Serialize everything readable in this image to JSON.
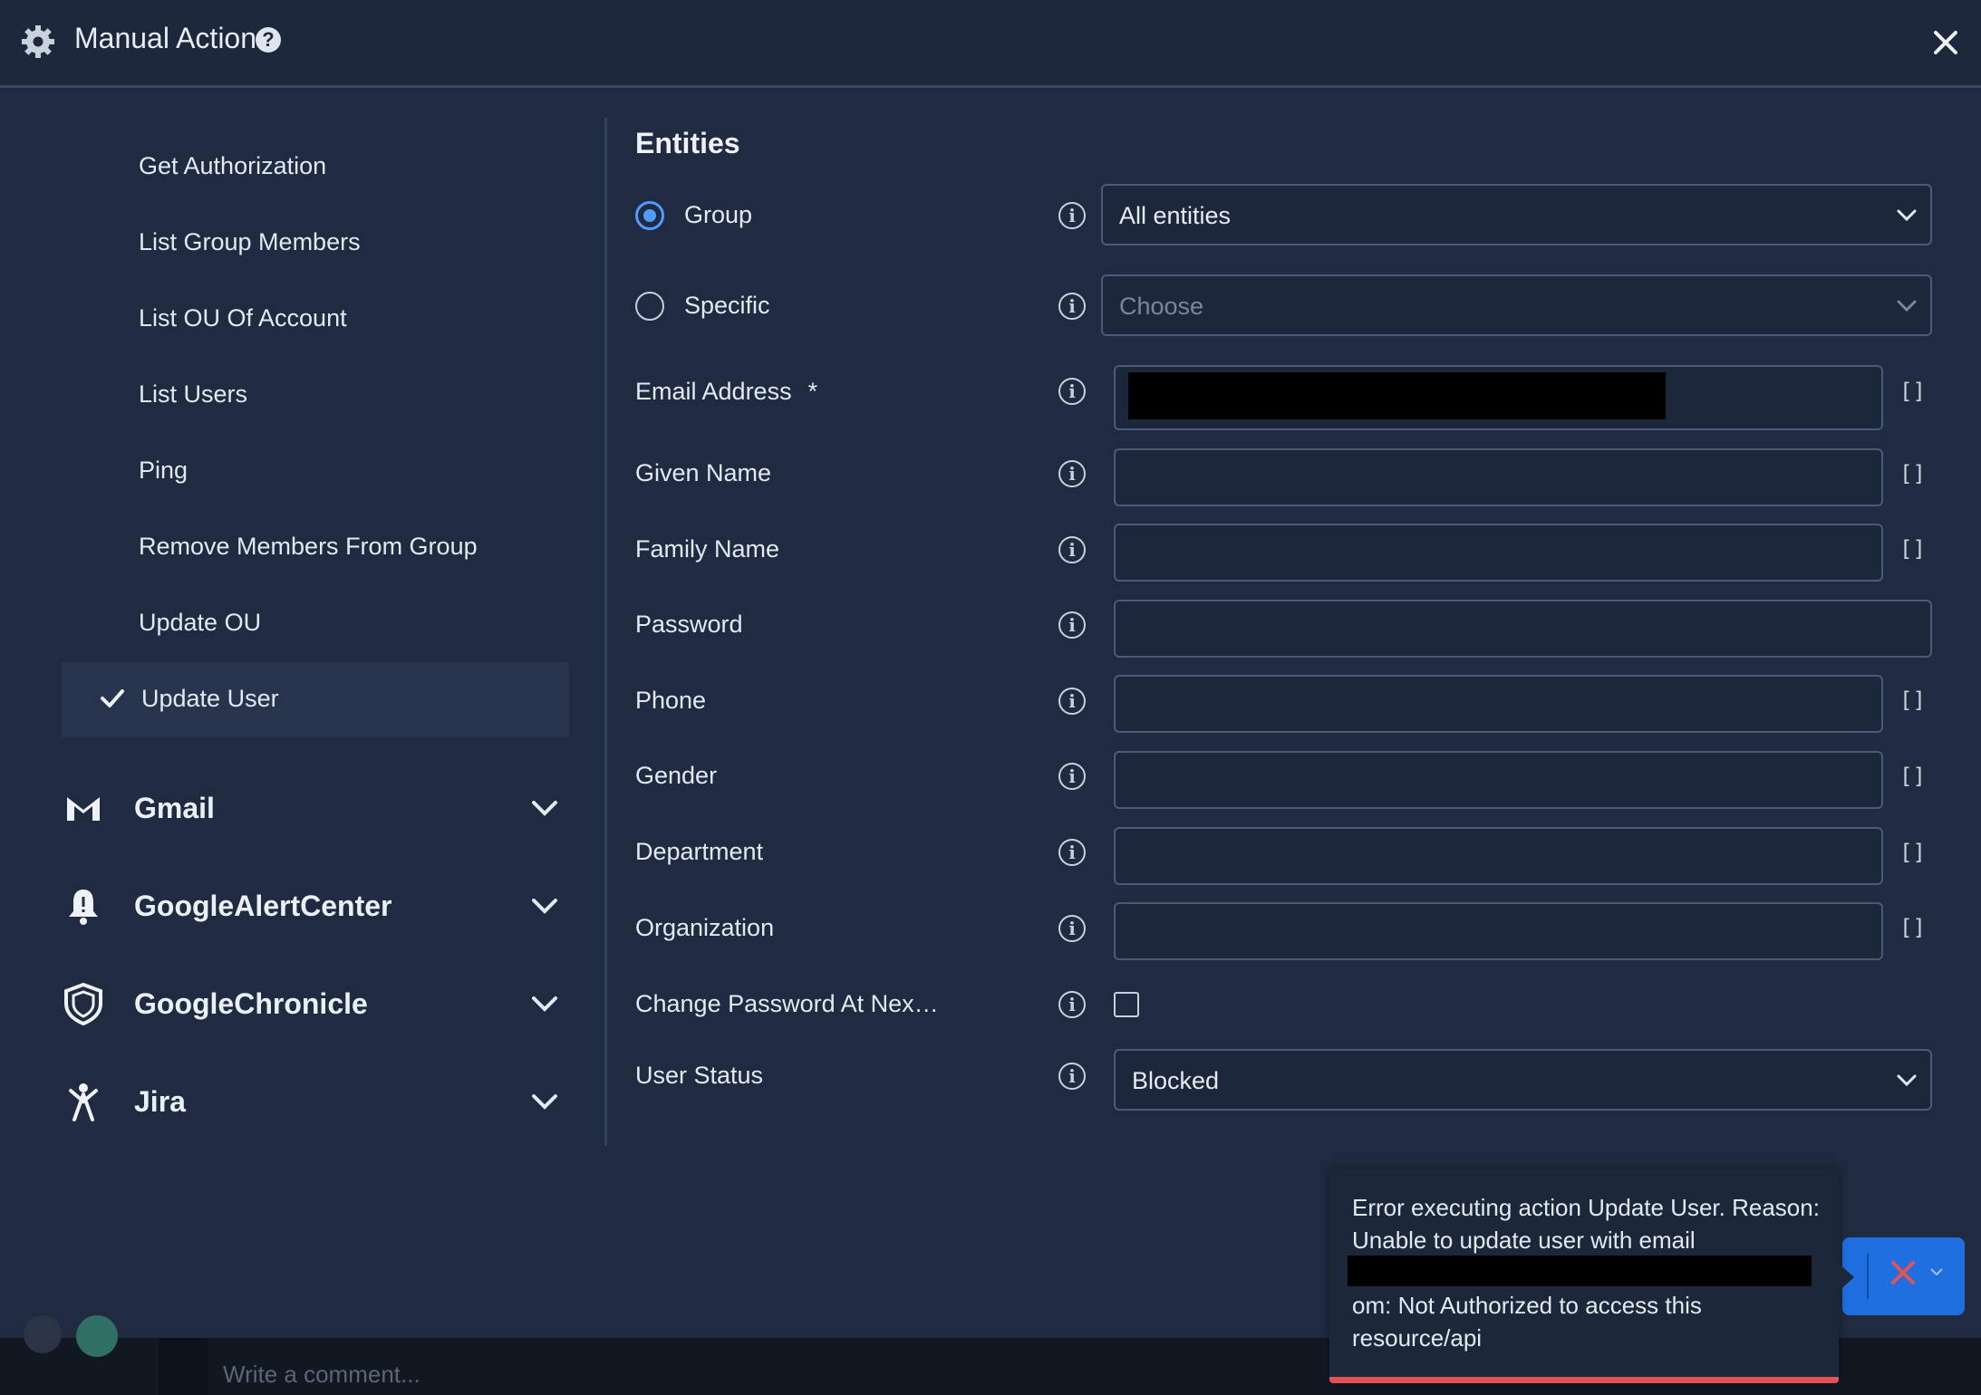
{
  "window": {
    "title": "Manual Action",
    "help_icon": "question-circle-icon",
    "close_icon": "close-icon"
  },
  "sidebar": {
    "actions": [
      "Get Authorization",
      "List Group Members",
      "List OU Of Account",
      "List Users",
      "Ping",
      "Remove Members From Group",
      "Update OU"
    ],
    "selected_action": "Update User",
    "groups": [
      {
        "label": "Gmail",
        "icon": "gmail-icon"
      },
      {
        "label": "GoogleAlertCenter",
        "icon": "bell-icon"
      },
      {
        "label": "GoogleChronicle",
        "icon": "shield-icon"
      },
      {
        "label": "Jira",
        "icon": "jira-icon"
      }
    ]
  },
  "main": {
    "section_title": "Entities",
    "group_label": "Group",
    "group_select": "All entities",
    "specific_label": "Specific",
    "specific_placeholder": "Choose",
    "fields": {
      "email": "Email Address",
      "email_required": "*",
      "given_name": "Given Name",
      "family_name": "Family Name",
      "password": "Password",
      "phone": "Phone",
      "gender": "Gender",
      "department": "Department",
      "organization": "Organization",
      "change_password": "Change Password At Nex…",
      "user_status": "User Status"
    },
    "user_status_value": "Blocked",
    "brackets": "[]",
    "info_glyph": "i"
  },
  "toast": {
    "line1": "Error executing action Update User. Reason:",
    "line2": "Unable to update user with email",
    "line3": "om: Not Authorized to access this",
    "line4": "resource/api"
  },
  "footer": {
    "comment_placeholder": "Write a comment..."
  },
  "colors": {
    "accent": "#4f9bff",
    "error": "#e45353",
    "button": "#1f6fe0",
    "background": "#202a40"
  }
}
